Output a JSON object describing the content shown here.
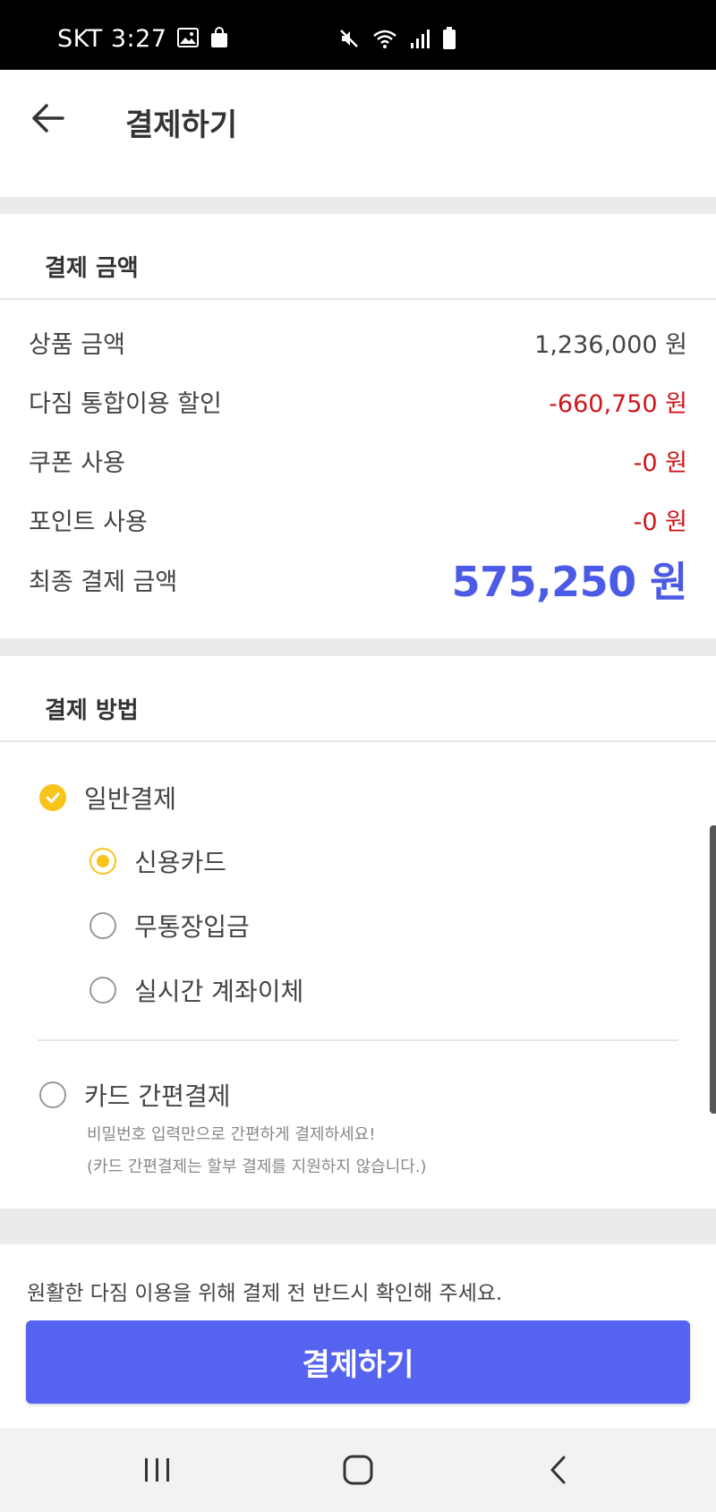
{
  "status_bar": {
    "carrier_time": "SKT 3:27",
    "icons": [
      "gallery-icon",
      "shopping-bag-icon",
      "mute-icon",
      "wifi-icon",
      "signal-icon",
      "battery-icon"
    ]
  },
  "header": {
    "title": "결제하기",
    "back_icon": "arrow-left-icon"
  },
  "payment_amount": {
    "title": "결제 금액",
    "rows": [
      {
        "label": "상품 금액",
        "value": "1,236,000 원"
      },
      {
        "label": "다짐 통합이용 할인",
        "value": "-660,750 원"
      },
      {
        "label": "쿠폰 사용",
        "value": "-0 원"
      },
      {
        "label": "포인트 사용",
        "value": "-0 원"
      }
    ],
    "total_label": "최종 결제 금액",
    "total_value": "575,250 원"
  },
  "payment_method": {
    "title": "결제 방법",
    "general": {
      "label": "일반결제",
      "checked": true
    },
    "sub_options": [
      {
        "label": "신용카드",
        "selected": true
      },
      {
        "label": "무통장입금",
        "selected": false
      },
      {
        "label": "실시간 계좌이체",
        "selected": false
      }
    ],
    "easy_pay": {
      "label": "카드 간편결제",
      "hint1": "비밀번호 입력만으로 간편하게 결제하세요!",
      "hint2": "(카드 간편결제는 할부 결제를 지원하지 않습니다.)"
    }
  },
  "notice": "원활한 다짐 이용을 위해 결제 전 반드시 확인해 주세요.",
  "pay_button": "결제하기",
  "colors": {
    "accent_blue": "#5563f0",
    "total_blue": "#4c5be5",
    "discount_red": "#d0161b",
    "check_yellow": "#f9c31a"
  },
  "nav_bar": {
    "icons": [
      "recent-apps-icon",
      "home-icon",
      "back-icon"
    ]
  }
}
